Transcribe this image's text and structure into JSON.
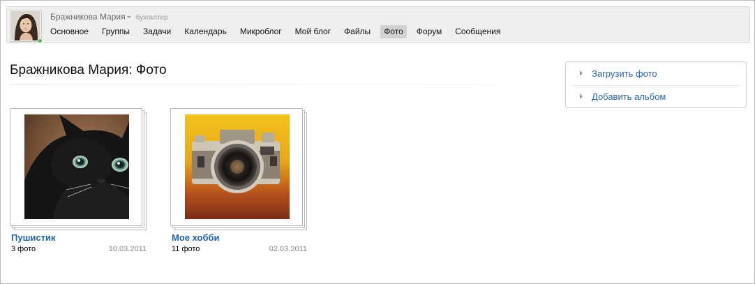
{
  "user": {
    "name": "Бражникова Мария",
    "role": "бухгалтер",
    "status": "online"
  },
  "nav": {
    "items": [
      {
        "label": "Основное",
        "active": false
      },
      {
        "label": "Группы",
        "active": false
      },
      {
        "label": "Задачи",
        "active": false
      },
      {
        "label": "Календарь",
        "active": false
      },
      {
        "label": "Микроблог",
        "active": false
      },
      {
        "label": "Мой блог",
        "active": false
      },
      {
        "label": "Файлы",
        "active": false
      },
      {
        "label": "Фото",
        "active": true
      },
      {
        "label": "Форум",
        "active": false
      },
      {
        "label": "Сообщения",
        "active": false
      }
    ]
  },
  "page": {
    "title": "Бражникова Мария: Фото"
  },
  "actions": [
    {
      "label": "Загрузить фото"
    },
    {
      "label": "Добавить альбом"
    }
  ],
  "albums": [
    {
      "name": "Пушистик",
      "count": "3 фото",
      "date": "10.03.2011",
      "cover": "black-cat-photo"
    },
    {
      "name": "Мое хобби",
      "count": "11 фото",
      "date": "02.03.2011",
      "cover": "vintage-camera-photo"
    }
  ],
  "colors": {
    "link": "#1f62ad",
    "action_link": "#2a66a6",
    "active_tab": "#d2d2d2",
    "online": "#3db83d"
  }
}
